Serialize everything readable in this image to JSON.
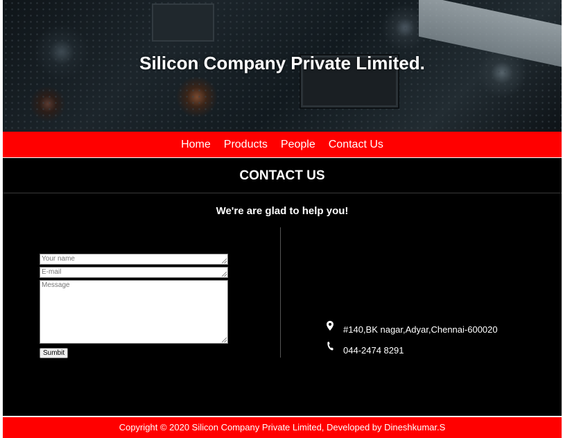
{
  "header": {
    "title": "Silicon Company Private Limited."
  },
  "nav": {
    "items": [
      {
        "label": "Home"
      },
      {
        "label": "Products"
      },
      {
        "label": "People"
      },
      {
        "label": "Contact Us"
      }
    ]
  },
  "contact": {
    "title": "CONTACT US",
    "subtitle": "We're are glad to help you!",
    "form": {
      "name_placeholder": "Your name",
      "email_placeholder": "E-mail",
      "message_placeholder": "Message",
      "submit_label": "Sumbit"
    },
    "info": {
      "address": "#140,BK nagar,Adyar,Chennai-600020",
      "address_icon": "map-marker-icon",
      "phone": "044-2474 8291",
      "phone_icon": "phone-icon"
    }
  },
  "footer": {
    "text": "Copyright © 2020 Silicon Company Private Limited, Developed by Dineshkumar.S"
  },
  "colors": {
    "accent": "#ff0000",
    "background": "#000000",
    "text": "#ffffff"
  }
}
